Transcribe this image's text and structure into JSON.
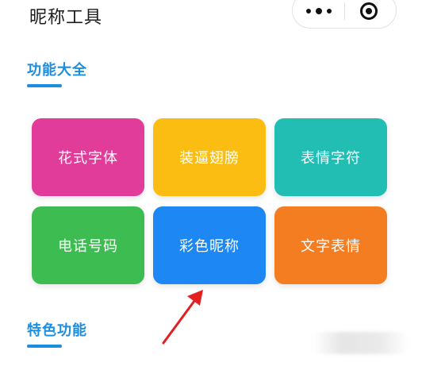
{
  "app": {
    "title": "昵称工具"
  },
  "capsule": {
    "more_icon": "more-dots-icon",
    "close_icon": "target-icon"
  },
  "sections": {
    "functions": {
      "title": "功能大全"
    },
    "featured": {
      "title": "特色功能"
    }
  },
  "grid": {
    "items": [
      {
        "label": "花式字体",
        "color": "#e23c9a"
      },
      {
        "label": "装逼翅膀",
        "color": "#fbbd12"
      },
      {
        "label": "表情字符",
        "color": "#22bdb3"
      },
      {
        "label": "电话号码",
        "color": "#3dbc51"
      },
      {
        "label": "彩色昵称",
        "color": "#1d87f3"
      },
      {
        "label": "文字表情",
        "color": "#f47d22"
      }
    ]
  },
  "colors": {
    "accent": "#1c8ee2",
    "arrow": "#e41f1f"
  }
}
